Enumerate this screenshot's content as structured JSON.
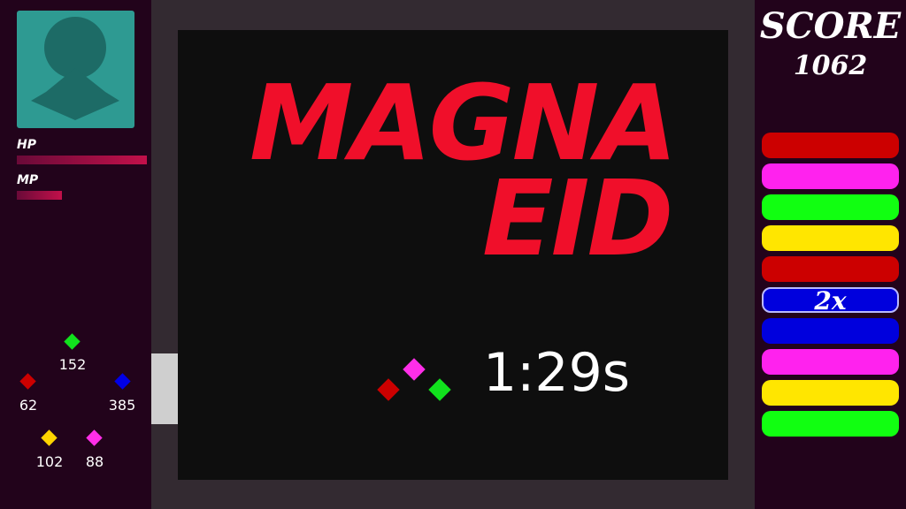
{
  "player": {
    "avatar_icon": "person-silhouette-icon",
    "hp_label": "HP",
    "mp_label": "MP",
    "hp_fraction": 1.0,
    "mp_fraction": 0.35
  },
  "gems": [
    {
      "color": "#11e11d",
      "count": "152"
    },
    {
      "color": "#cc0000",
      "count": "62"
    },
    {
      "color": "#0000e6",
      "count": "385"
    },
    {
      "color": "#ffd400",
      "count": "102"
    },
    {
      "color": "#ff2ee8",
      "count": "88"
    }
  ],
  "game": {
    "title_line1": "MAGNA",
    "title_line2": "EID",
    "timer": "1:29s",
    "cluster_gems": [
      {
        "color": "#cc0000"
      },
      {
        "color": "#ff2ee8"
      },
      {
        "color": "#11e11d"
      }
    ]
  },
  "score": {
    "label": "SCORE",
    "value": "1062"
  },
  "queue": [
    {
      "color": "#cc0000",
      "text": ""
    },
    {
      "color": "#ff22ee",
      "text": ""
    },
    {
      "color": "#11ff11",
      "text": ""
    },
    {
      "color": "#ffe600",
      "text": ""
    },
    {
      "color": "#cc0000",
      "text": ""
    },
    {
      "color": "#0000dd",
      "text": "2x"
    },
    {
      "color": "#0000dd",
      "text": ""
    },
    {
      "color": "#ff22ee",
      "text": ""
    },
    {
      "color": "#ffe600",
      "text": ""
    },
    {
      "color": "#11ff11",
      "text": ""
    }
  ],
  "colors": {
    "hp_bar": "#c2104a",
    "mp_bar": "#c2104a",
    "title": "#f00f2a",
    "panel": "#22031b"
  }
}
